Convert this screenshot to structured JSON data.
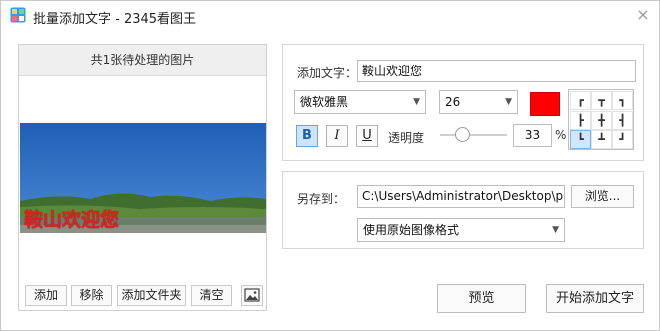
{
  "window": {
    "title": "批量添加文字 - 2345看图王",
    "close_glyph": "×",
    "app_icon": "app-icon"
  },
  "left_panel": {
    "header": "共1张待处理的图片",
    "overlay_text": "鞍山欢迎您",
    "buttons": {
      "add": "添加",
      "remove": "移除",
      "add_folder": "添加文件夹",
      "clear": "清空"
    },
    "image_button_icon": "image-icon"
  },
  "text_settings": {
    "add_text_label": "添加文字：",
    "text_value": "鞍山欢迎您",
    "font_family": "微软雅黑",
    "font_size": "26",
    "color": "#ff0000",
    "bold": "B",
    "italic": "I",
    "underline": "U",
    "opacity_label": "透明度",
    "opacity_value": "33",
    "opacity_unit": "%",
    "opacity_level": 0.33,
    "position_glyphs": [
      "┏",
      "┳",
      "┓",
      "┣",
      "╋",
      "┫",
      "┗",
      "┻",
      "┛"
    ],
    "position_selected": 6
  },
  "save_settings": {
    "save_to_label": "另存到：",
    "path_value": "C:\\Users\\Administrator\\Desktop\\pic\\",
    "browse_label": "浏览...",
    "format_value": "使用原始图像格式"
  },
  "footer": {
    "preview_label": "预览",
    "start_label": "开始添加文字"
  }
}
